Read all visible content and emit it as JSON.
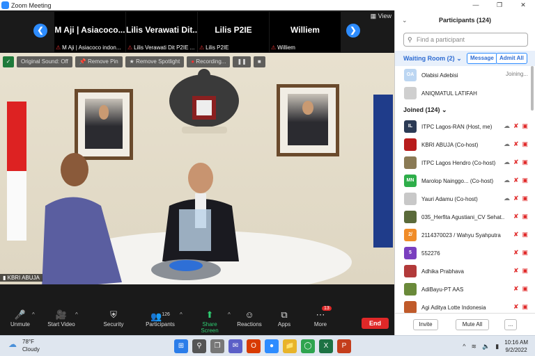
{
  "titlebar": {
    "title": "Zoom Meeting"
  },
  "thumbs": [
    {
      "name": "M Aji | Asiacoco...",
      "label": "M Aji | Asiacoco indon..."
    },
    {
      "name": "Lilis Verawati Dit...",
      "label": "Lilis Verawati Dit P2IE ..."
    },
    {
      "name": "Lilis P2IE",
      "label": "Lilis P2IE"
    },
    {
      "name": "Williem",
      "label": "Williem"
    }
  ],
  "view_label": "View",
  "overlay": {
    "sound": "Original Sound: Off",
    "remove_pin": "Remove Pin",
    "remove_spotlight": "Remove Spotlight",
    "recording": "Recording..."
  },
  "speaker_name": "KBRI ABUJA",
  "toolbar": {
    "unmute": "Unmute",
    "start_video": "Start Video",
    "security": "Security",
    "participants": "Participants",
    "participants_count": "126",
    "share": "Share Screen",
    "reactions": "Reactions",
    "apps": "Apps",
    "more": "More",
    "more_badge": "13",
    "end": "End"
  },
  "panel": {
    "title": "Participants (124)",
    "search_placeholder": "Find a participant",
    "waiting_label": "Waiting Room (2)",
    "message": "Message",
    "admit_all": "Admit All",
    "waiting": [
      {
        "name": "Olabisi Adebisi",
        "status": "Joining...",
        "initials": "OA",
        "color": "#bcd6f2"
      },
      {
        "name": "ANIQMATUL LATIFAH",
        "status": "",
        "initials": "",
        "color": "#cfcfcf"
      }
    ],
    "joined_label": "Joined (124)",
    "joined": [
      {
        "name": "ITPC Lagos-RAN (Host, me)",
        "initials": "IL",
        "color": "#2b3a55"
      },
      {
        "name": "KBRI ABUJA (Co-host)",
        "initials": "",
        "color": "#b81c1c"
      },
      {
        "name": "ITPC Lagos Hendro (Co-host)",
        "initials": "",
        "color": "#8a7a55"
      },
      {
        "name": "Marolop Nainggo... (Co-host)",
        "initials": "MN",
        "color": "#2eae4a"
      },
      {
        "name": "Yauri Adamu (Co-host)",
        "initials": "",
        "color": "#c8c8c8"
      },
      {
        "name": "035_Herfita Agustiani_CV Sehat...",
        "initials": "",
        "color": "#5a6a3a"
      },
      {
        "name": "2114370023 / Wahyu Syahputra",
        "initials": "2/",
        "color": "#f08c28"
      },
      {
        "name": "552276",
        "initials": "5",
        "color": "#7a3fbf"
      },
      {
        "name": "Adhika Prabhava",
        "initials": "",
        "color": "#b23a3a"
      },
      {
        "name": "AdiBayu-PT AAS",
        "initials": "",
        "color": "#6a8a3a"
      },
      {
        "name": "Agi Aditya Lotte Indonesia",
        "initials": "",
        "color": "#c05a2a"
      }
    ],
    "invite": "Invite",
    "mute_all": "Mute All",
    "more_dots": "..."
  },
  "taskbar": {
    "temp": "78°F",
    "weather": "Cloudy",
    "time": "10:16 AM",
    "date": "9/2/2022"
  }
}
